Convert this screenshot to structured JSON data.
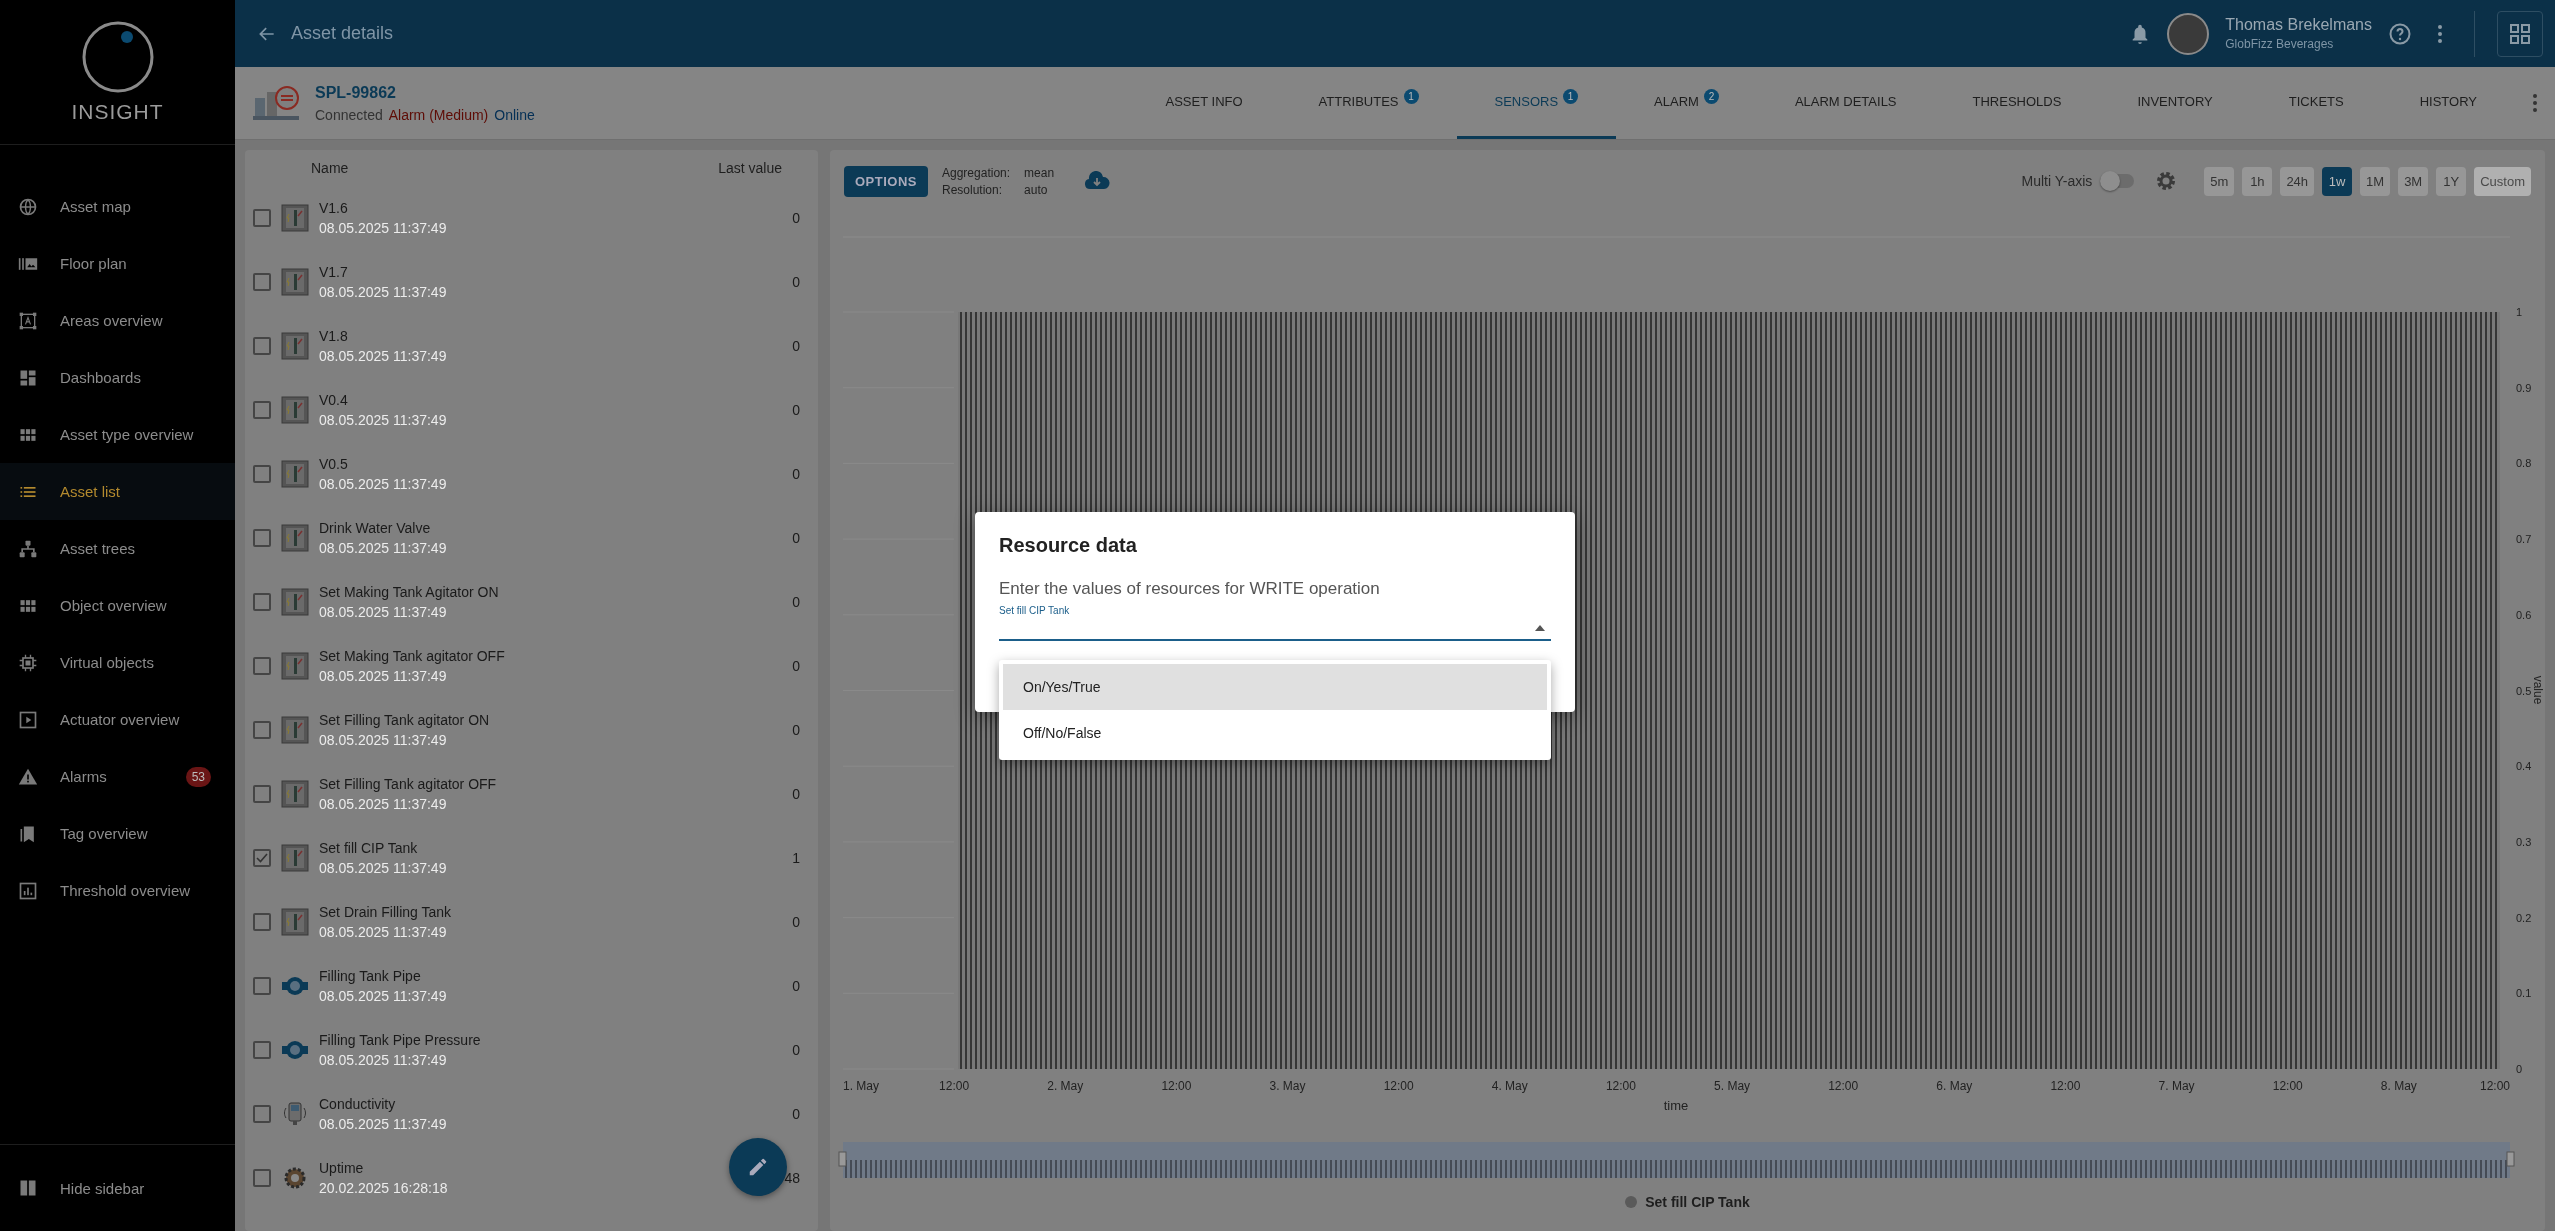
{
  "sidebar": {
    "logo": "INSIGHT",
    "items": [
      {
        "label": "Asset map",
        "kind": "globe",
        "selected": false
      },
      {
        "label": "Floor plan",
        "kind": "image",
        "selected": false
      },
      {
        "label": "Areas overview",
        "kind": "frame",
        "selected": false
      },
      {
        "label": "Dashboards",
        "kind": "dashboard",
        "selected": false
      },
      {
        "label": "Asset type overview",
        "kind": "grid",
        "selected": false
      },
      {
        "label": "Asset list",
        "kind": "list",
        "selected": true
      },
      {
        "label": "Asset trees",
        "kind": "tree",
        "selected": false
      },
      {
        "label": "Object overview",
        "kind": "grid",
        "selected": false
      },
      {
        "label": "Virtual objects",
        "kind": "chip",
        "selected": false
      },
      {
        "label": "Actuator overview",
        "kind": "play",
        "selected": false
      },
      {
        "label": "Alarms",
        "kind": "warning",
        "selected": false,
        "badge": "53"
      },
      {
        "label": "Tag overview",
        "kind": "bookmark",
        "selected": false
      },
      {
        "label": "Threshold overview",
        "kind": "chart",
        "selected": false
      }
    ],
    "footer": "Hide sidebar"
  },
  "header": {
    "title": "Asset details",
    "user": {
      "name": "Thomas Brekelmans",
      "org": "GlobFizz Beverages"
    }
  },
  "asset": {
    "id": "SPL-99862",
    "connection": "Connected",
    "alarm": "Alarm (Medium)",
    "status": "Online"
  },
  "tabs": [
    {
      "label": "ASSET INFO",
      "selected": false
    },
    {
      "label": "ATTRIBUTES",
      "selected": false,
      "badge": "1"
    },
    {
      "label": "SENSORS",
      "selected": true,
      "badge": "1"
    },
    {
      "label": "ALARM",
      "selected": false,
      "badge": "2"
    },
    {
      "label": "ALARM DETAILS",
      "selected": false
    },
    {
      "label": "THRESHOLDS",
      "selected": false
    },
    {
      "label": "INVENTORY",
      "selected": false
    },
    {
      "label": "TICKETS",
      "selected": false
    },
    {
      "label": "HISTORY",
      "selected": false
    }
  ],
  "sensor_list": {
    "columns": [
      "Name",
      "Last value"
    ],
    "rows": [
      {
        "name": "V1.6",
        "timestamp": "08.05.2025 11:37:49",
        "value": "0",
        "checked": false,
        "kind": "switch"
      },
      {
        "name": "V1.7",
        "timestamp": "08.05.2025 11:37:49",
        "value": "0",
        "checked": false,
        "kind": "switch"
      },
      {
        "name": "V1.8",
        "timestamp": "08.05.2025 11:37:49",
        "value": "0",
        "checked": false,
        "kind": "switch"
      },
      {
        "name": "V0.4",
        "timestamp": "08.05.2025 11:37:49",
        "value": "0",
        "checked": false,
        "kind": "switch"
      },
      {
        "name": "V0.5",
        "timestamp": "08.05.2025 11:37:49",
        "value": "0",
        "checked": false,
        "kind": "switch"
      },
      {
        "name": "Drink Water Valve",
        "timestamp": "08.05.2025 11:37:49",
        "value": "0",
        "checked": false,
        "kind": "switch"
      },
      {
        "name": "Set Making Tank Agitator ON",
        "timestamp": "08.05.2025 11:37:49",
        "value": "0",
        "checked": false,
        "kind": "switch"
      },
      {
        "name": "Set Making Tank agitator OFF",
        "timestamp": "08.05.2025 11:37:49",
        "value": "0",
        "checked": false,
        "kind": "switch"
      },
      {
        "name": "Set Filling Tank agitator ON",
        "timestamp": "08.05.2025 11:37:49",
        "value": "0",
        "checked": false,
        "kind": "switch"
      },
      {
        "name": "Set Filling Tank agitator OFF",
        "timestamp": "08.05.2025 11:37:49",
        "value": "0",
        "checked": false,
        "kind": "switch"
      },
      {
        "name": "Set fill CIP Tank",
        "timestamp": "08.05.2025 11:37:49",
        "value": "1",
        "checked": true,
        "kind": "switch"
      },
      {
        "name": "Set Drain Filling Tank",
        "timestamp": "08.05.2025 11:37:49",
        "value": "0",
        "checked": false,
        "kind": "switch"
      },
      {
        "name": "Filling Tank Pipe",
        "timestamp": "08.05.2025 11:37:49",
        "value": "0",
        "checked": false,
        "kind": "pipe"
      },
      {
        "name": "Filling Tank Pipe Pressure",
        "timestamp": "08.05.2025 11:37:49",
        "value": "0",
        "checked": false,
        "kind": "pipe"
      },
      {
        "name": "Conductivity",
        "timestamp": "08.05.2025 11:37:49",
        "value": "0",
        "checked": false,
        "kind": "meter"
      },
      {
        "name": "Uptime",
        "timestamp": "20.02.2025 16:28:18",
        "value": "48",
        "checked": false,
        "kind": "gear"
      }
    ]
  },
  "chart_panel": {
    "options_button": "OPTIONS",
    "settings": [
      {
        "label": "Aggregation:",
        "value": "mean"
      },
      {
        "label": "Resolution:",
        "value": "auto"
      }
    ],
    "multi_y_axis": {
      "label": "Multi Y-axis",
      "on": false
    },
    "ranges": [
      {
        "label": "5m",
        "selected": false,
        "disabled": false
      },
      {
        "label": "1h",
        "selected": false,
        "disabled": false
      },
      {
        "label": "24h",
        "selected": false,
        "disabled": false
      },
      {
        "label": "1w",
        "selected": true,
        "disabled": false
      },
      {
        "label": "1M",
        "selected": false,
        "disabled": false
      },
      {
        "label": "3M",
        "selected": false,
        "disabled": false
      },
      {
        "label": "1Y",
        "selected": false,
        "disabled": false
      },
      {
        "label": "Custom",
        "selected": false,
        "disabled": true
      }
    ],
    "chart": {
      "xlabel": "time",
      "ylabel": "value",
      "x_ticks": [
        "1. May",
        "12:00",
        "2. May",
        "12:00",
        "3. May",
        "12:00",
        "4. May",
        "12:00",
        "5. May",
        "12:00",
        "6. May",
        "12:00",
        "7. May",
        "12:00",
        "8. May",
        "12:00"
      ],
      "y_ticks": [
        "1",
        "0.9",
        "0.8",
        "0.7",
        "0.6",
        "0.5",
        "0.4",
        "0.3",
        "0.2",
        "0.1",
        "0"
      ],
      "legend": "Set fill CIP Tank"
    }
  },
  "dialog": {
    "title": "Resource data",
    "text": "Enter the values of resources for WRITE operation",
    "field": {
      "label": "Set fill CIP Tank",
      "expanded": true
    },
    "options": [
      {
        "label": "On/Yes/True",
        "selected": true
      },
      {
        "label": "Off/No/False",
        "selected": false
      }
    ]
  }
}
